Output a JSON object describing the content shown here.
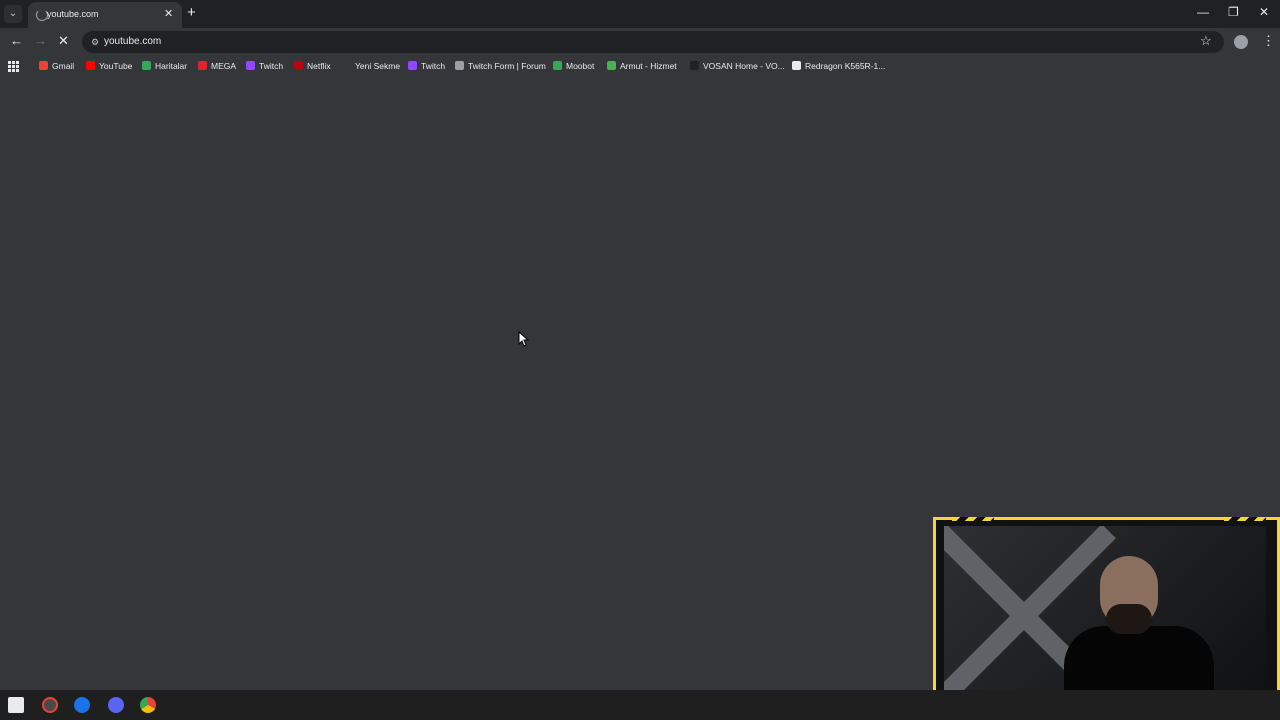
{
  "tab": {
    "title": "youtube.com",
    "close": "✕"
  },
  "window": {
    "minimize": "—",
    "restore": "❐",
    "close": "✕"
  },
  "toolbar": {
    "url": "youtube.com"
  },
  "bookmarks": [
    {
      "label": "Gmail",
      "color": "#ea4335"
    },
    {
      "label": "YouTube",
      "color": "#ff0000"
    },
    {
      "label": "Haritalar",
      "color": "#34a853"
    },
    {
      "label": "MEGA",
      "color": "#d9272e"
    },
    {
      "label": "Twitch",
      "color": "#9146ff"
    },
    {
      "label": "Netflix",
      "color": "#b20710"
    },
    {
      "label": "Yeni Sekme",
      "color": "#35363a"
    },
    {
      "label": "Twitch",
      "color": "#9146ff"
    },
    {
      "label": "Twitch Form | Forum",
      "color": "#9aa0a6"
    },
    {
      "label": "Moobot",
      "color": "#34a853"
    },
    {
      "label": "Armut - Hizmet",
      "color": "#4caf50"
    },
    {
      "label": "VOSAN Home - VO...",
      "color": "#202124"
    },
    {
      "label": "Redragon K565R-1...",
      "color": "#e8eaed"
    }
  ],
  "taskbar": [
    "windows-start-icon",
    "obs-icon",
    "steam-icon",
    "discord-icon",
    "chrome-icon"
  ]
}
